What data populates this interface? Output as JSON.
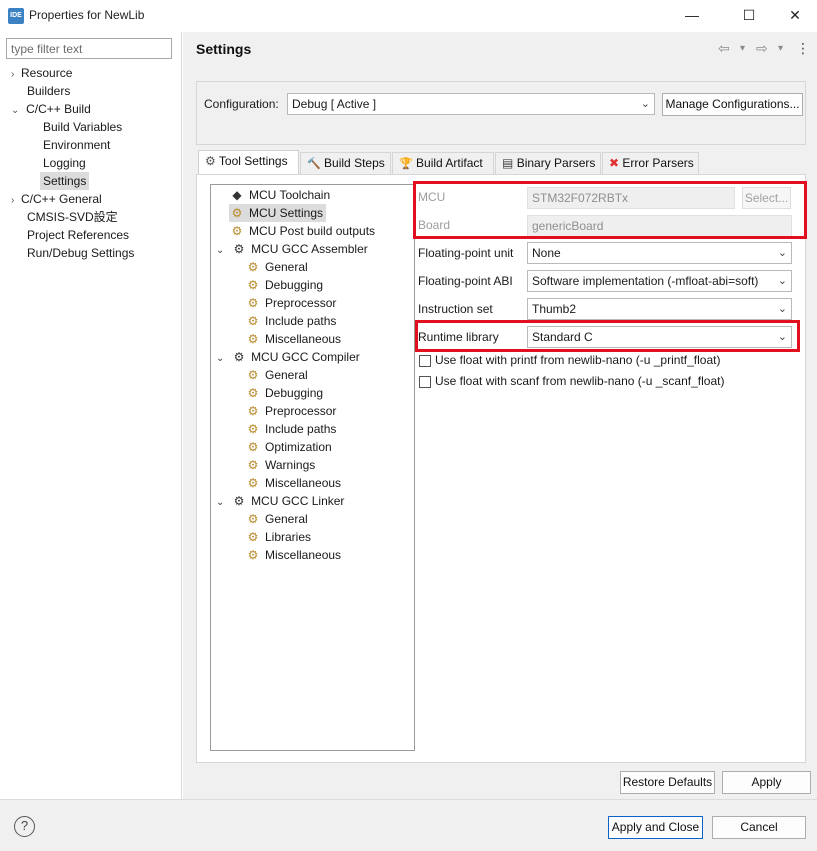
{
  "window": {
    "icon_text": "IDE",
    "title": "Properties for NewLib",
    "minimize_glyph": "—",
    "maximize_glyph": "☐",
    "close_glyph": "✕"
  },
  "sidebar": {
    "filter_placeholder": "type filter text",
    "items": [
      {
        "label": "Resource",
        "arrow": "›"
      },
      {
        "label": "Builders"
      },
      {
        "label": "C/C++ Build",
        "arrow": "⌄"
      },
      {
        "label": "Build Variables"
      },
      {
        "label": "Environment"
      },
      {
        "label": "Logging"
      },
      {
        "label": "Settings"
      },
      {
        "label": "C/C++ General",
        "arrow": "›"
      },
      {
        "label": "CMSIS-SVD設定"
      },
      {
        "label": "Project References"
      },
      {
        "label": "Run/Debug Settings"
      }
    ]
  },
  "header": {
    "title": "Settings",
    "back_glyph": "⇦",
    "forward_glyph": "⇨",
    "dropdown_glyph": "▾",
    "menu_glyph": "⋮"
  },
  "configuration": {
    "label": "Configuration:",
    "value": "Debug  [ Active ]",
    "manage_button": "Manage Configurations..."
  },
  "tabs": [
    {
      "label": "Tool Settings",
      "icon": "gear-icon",
      "glyph": "⚙"
    },
    {
      "label": "Build Steps",
      "icon": "hammer-icon",
      "glyph": "🔨"
    },
    {
      "label": "Build Artifact",
      "icon": "trophy-icon",
      "glyph": "🏆"
    },
    {
      "label": "Binary Parsers",
      "icon": "binary-doc-icon",
      "glyph": "▤"
    },
    {
      "label": "Error Parsers",
      "icon": "error-icon",
      "glyph": "✖"
    }
  ],
  "tool_tree": {
    "items": [
      {
        "label": "MCU Toolchain",
        "glyph": "◆"
      },
      {
        "label": "MCU Settings",
        "glyph": "⚙"
      },
      {
        "label": "MCU Post build outputs",
        "glyph": "⚙"
      },
      {
        "label": "MCU GCC Assembler",
        "glyph": "⚙",
        "chevron": "⌄"
      },
      {
        "label": "General",
        "glyph": "⚙"
      },
      {
        "label": "Debugging",
        "glyph": "⚙"
      },
      {
        "label": "Preprocessor",
        "glyph": "⚙"
      },
      {
        "label": "Include paths",
        "glyph": "⚙"
      },
      {
        "label": "Miscellaneous",
        "glyph": "⚙"
      },
      {
        "label": "MCU GCC Compiler",
        "glyph": "⚙",
        "chevron": "⌄"
      },
      {
        "label": "General",
        "glyph": "⚙"
      },
      {
        "label": "Debugging",
        "glyph": "⚙"
      },
      {
        "label": "Preprocessor",
        "glyph": "⚙"
      },
      {
        "label": "Include paths",
        "glyph": "⚙"
      },
      {
        "label": "Optimization",
        "glyph": "⚙"
      },
      {
        "label": "Warnings",
        "glyph": "⚙"
      },
      {
        "label": "Miscellaneous",
        "glyph": "⚙"
      },
      {
        "label": "MCU GCC Linker",
        "glyph": "⚙",
        "chevron": "⌄"
      },
      {
        "label": "General",
        "glyph": "⚙"
      },
      {
        "label": "Libraries",
        "glyph": "⚙"
      },
      {
        "label": "Miscellaneous",
        "glyph": "⚙"
      }
    ]
  },
  "mcu_settings": {
    "mcu_label": "MCU",
    "mcu_value": "STM32F072RBTx",
    "select_button": "Select...",
    "board_label": "Board",
    "board_value": "genericBoard",
    "fpu_label": "Floating-point unit",
    "fpu_value": "None",
    "fpabi_label": "Floating-point ABI",
    "fpabi_value": "Software implementation (-mfloat-abi=soft)",
    "iset_label": "Instruction set",
    "iset_value": "Thumb2",
    "runtime_label": "Runtime library",
    "runtime_value": "Standard C",
    "printf_float_label": "Use float with printf from newlib-nano (-u _printf_float)",
    "scanf_float_label": "Use float with scanf from newlib-nano (-u _scanf_float)",
    "chevron": "⌄"
  },
  "buttons": {
    "restore_defaults": "Restore Defaults",
    "apply": "Apply",
    "apply_and_close": "Apply and Close",
    "cancel": "Cancel",
    "help": "?"
  },
  "colors": {
    "highlight_red": "#e0101e",
    "primary_button_border": "#0a64c8",
    "panel_bg": "#f0f0f0"
  }
}
